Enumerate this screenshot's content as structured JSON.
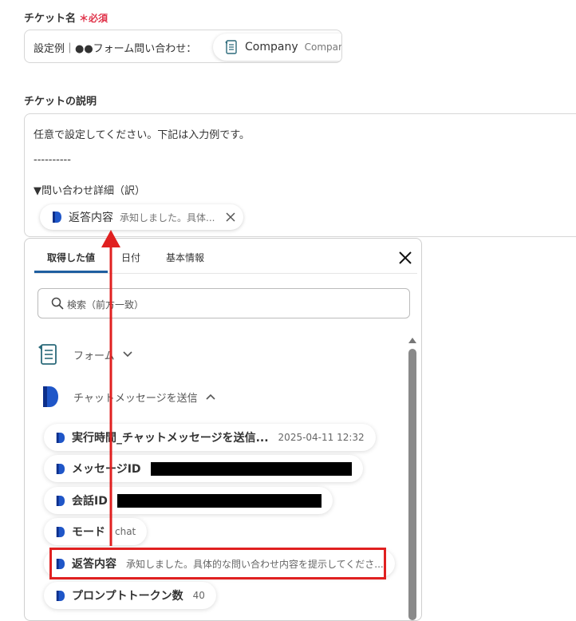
{
  "ticket_name": {
    "label": "チケット名",
    "required_mark": "＊必須",
    "prefix_text": "設定例｜●●フォーム問い合わせ：",
    "chip_label": "Company",
    "chip_sub": "Compar"
  },
  "ticket_description": {
    "label": "チケットの説明",
    "line1": "任意で設定してください。下記は入力例です。",
    "line2": "----------",
    "line3": "▼問い合わせ詳細（訳）",
    "chip_label": "返答内容",
    "chip_sub": "承知しました。具体..."
  },
  "picker": {
    "tabs": [
      "取得した値",
      "日付",
      "基本情報"
    ],
    "active_tab": 0,
    "search_placeholder": "検索（前方一致）",
    "groups": [
      {
        "name": "フォーム",
        "icon": "form-icon",
        "expanded": false
      },
      {
        "name": "チャットメッセージを送信",
        "icon": "dify-icon",
        "expanded": true
      }
    ],
    "items": [
      {
        "key": "実行時間_チャットメッセージを送信...",
        "value": "2025-04-11 12:32"
      },
      {
        "key": "メッセージID",
        "value": ""
      },
      {
        "key": "会話ID",
        "value": ""
      },
      {
        "key": "モード",
        "value": "chat"
      },
      {
        "key": "返答内容",
        "value": "承知しました。具体的な問い合わせ内容を提示してくださ..."
      },
      {
        "key": "プロンプトトークン数",
        "value": "40"
      }
    ]
  },
  "colors": {
    "accent": "#1f5fa0",
    "required": "#e0334a",
    "highlight": "#e02020"
  }
}
